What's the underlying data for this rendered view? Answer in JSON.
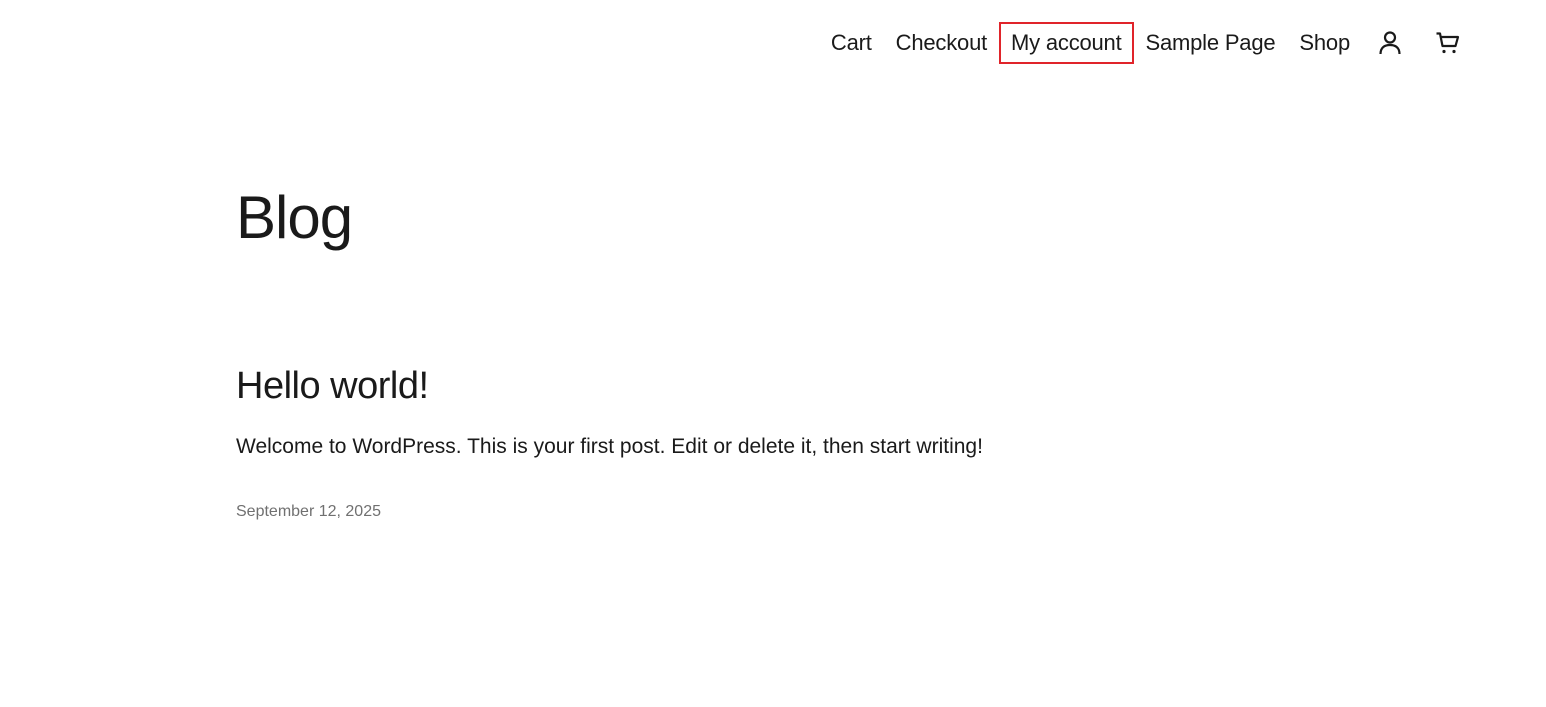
{
  "header": {
    "nav": {
      "cart_label": "Cart",
      "checkout_label": "Checkout",
      "my_account_label": "My account",
      "sample_page_label": "Sample Page",
      "shop_label": "Shop"
    },
    "icons": {
      "account": "user-icon",
      "cart": "cart-icon"
    },
    "highlight_color": "#e0242a"
  },
  "main": {
    "page_title": "Blog",
    "posts": [
      {
        "title": "Hello world!",
        "excerpt": "Welcome to WordPress. This is your first post. Edit or delete it, then start writing!",
        "date": "September 12, 2025"
      }
    ]
  }
}
